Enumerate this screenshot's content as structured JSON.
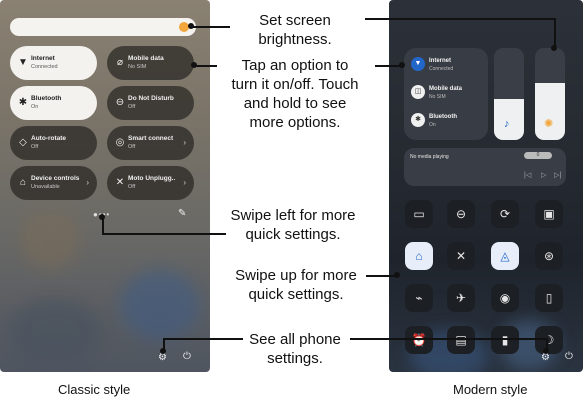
{
  "captions": {
    "classic": "Classic style",
    "modern": "Modern style"
  },
  "annotations": {
    "brightness": [
      "Set screen",
      "brightness."
    ],
    "tap": [
      "Tap an option to",
      "turn it on/off. Touch",
      "and hold to see",
      "more options."
    ],
    "swipe_left": [
      "Swipe left for more",
      "quick settings."
    ],
    "swipe_up": [
      "Swipe up for more",
      "quick settings."
    ],
    "settings": [
      "See all phone",
      "settings."
    ]
  },
  "classic": {
    "tiles": [
      {
        "title": "Internet",
        "sub": "Connected",
        "icon": "wifi-icon",
        "glyph": "▼",
        "on": true
      },
      {
        "title": "Mobile data",
        "sub": "No SIM",
        "icon": "mobile-data-icon",
        "glyph": "⌀",
        "on": false
      },
      {
        "title": "Bluetooth",
        "sub": "On",
        "icon": "bluetooth-icon",
        "glyph": "✱",
        "on": true
      },
      {
        "title": "Do Not Disturb",
        "sub": "Off",
        "icon": "do-not-disturb-icon",
        "glyph": "⊖",
        "on": false
      },
      {
        "title": "Auto-rotate",
        "sub": "Off",
        "icon": "auto-rotate-icon",
        "glyph": "◇",
        "on": false
      },
      {
        "title": "Smart connect",
        "sub": "Off",
        "icon": "smart-connect-icon",
        "glyph": "◎",
        "on": false
      },
      {
        "title": "Device controls",
        "sub": "Unavailable",
        "icon": "home-icon",
        "glyph": "⌂",
        "on": false
      },
      {
        "title": "Moto Unplugg..",
        "sub": "Off",
        "icon": "unplugged-icon",
        "glyph": "✕",
        "on": false
      }
    ],
    "brightness_level": 1.0
  },
  "modern": {
    "connectivity": [
      {
        "title": "Internet",
        "sub": "Connected",
        "icon": "wifi-icon",
        "glyph": "▼"
      },
      {
        "title": "Mobile data",
        "sub": "No SIM",
        "icon": "mobile-data-icon",
        "glyph": "◫"
      },
      {
        "title": "Bluetooth",
        "sub": "On",
        "icon": "bluetooth-icon",
        "glyph": "✱"
      }
    ],
    "media": {
      "status": "No media playing",
      "badge": "0"
    },
    "volume_level": 0.45,
    "brightness_level": 0.62
  },
  "colors": {
    "accent": "#f2a63b",
    "active_blue": "#2366c9"
  }
}
